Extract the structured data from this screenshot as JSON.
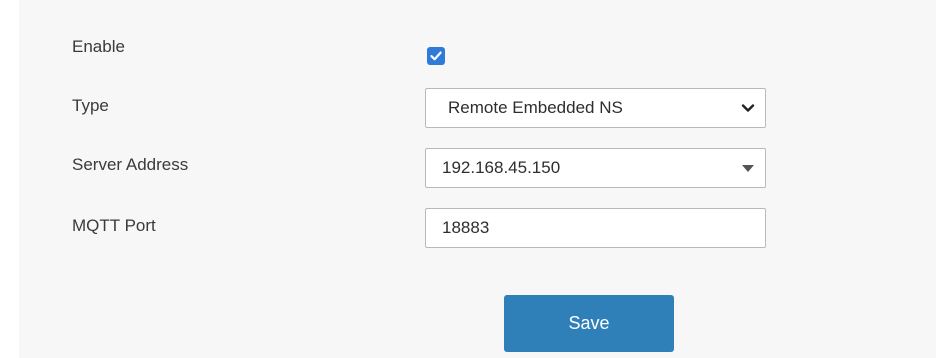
{
  "form": {
    "enable": {
      "label": "Enable",
      "checked": true,
      "checkbox_color": "#2f7bd9"
    },
    "type": {
      "label": "Type",
      "value": "Remote Embedded NS",
      "icon": "chevron-down-icon"
    },
    "server_address": {
      "label": "Server Address",
      "value": "192.168.45.150",
      "icon": "caret-down-icon"
    },
    "mqtt_port": {
      "label": "MQTT Port",
      "value": "18883"
    },
    "save_label": "Save",
    "save_color": "#2f80b9"
  }
}
